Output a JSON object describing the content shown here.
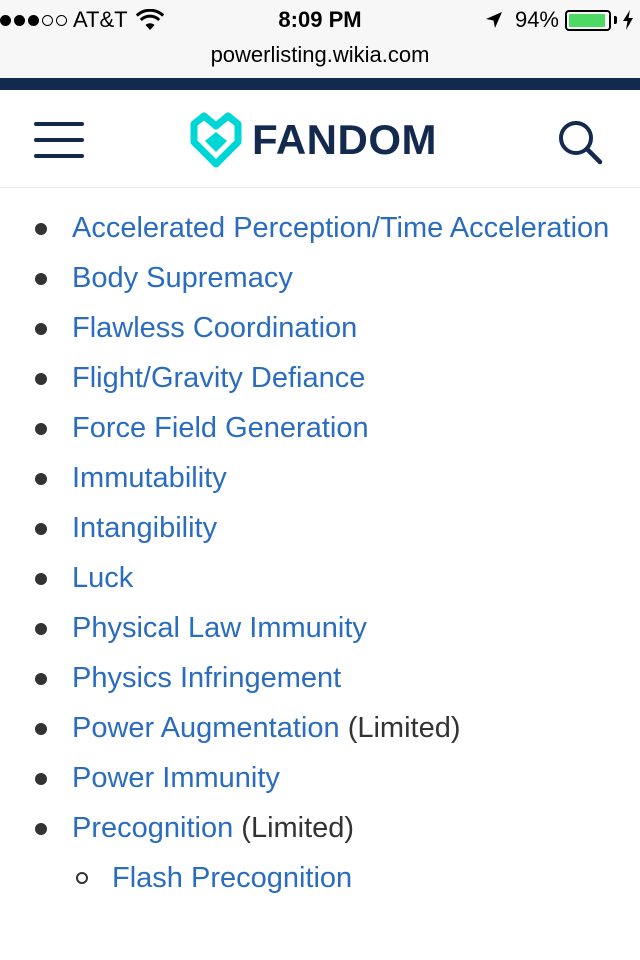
{
  "status_bar": {
    "carrier": "AT&T",
    "time": "8:09 PM",
    "battery_percent": "94%",
    "battery_level": 0.94,
    "battery_color": "#4cd964",
    "signal_bars_filled": 3,
    "signal_bars_total": 5
  },
  "browser": {
    "url": "powerlisting.wikia.com"
  },
  "header": {
    "logo_text": "FANDOM",
    "brand_color": "#132a4e",
    "accent_color": "#00d6d6",
    "menu_icon": "hamburger-menu-icon",
    "search_icon": "search-icon"
  },
  "powers": [
    {
      "label": "Accelerated Perception/Time Acceleration",
      "note": ""
    },
    {
      "label": "Body Supremacy",
      "note": ""
    },
    {
      "label": "Flawless Coordination",
      "note": ""
    },
    {
      "label": "Flight/Gravity Defiance",
      "note": ""
    },
    {
      "label": "Force Field Generation",
      "note": ""
    },
    {
      "label": "Immutability",
      "note": ""
    },
    {
      "label": "Intangibility",
      "note": ""
    },
    {
      "label": "Luck",
      "note": ""
    },
    {
      "label": "Physical Law Immunity",
      "note": ""
    },
    {
      "label": "Physics Infringement",
      "note": ""
    },
    {
      "label": "Power Augmentation",
      "note": "(Limited)"
    },
    {
      "label": "Power Immunity",
      "note": ""
    },
    {
      "label": "Precognition",
      "note": "(Limited)",
      "children": [
        {
          "label": "Flash Precognition"
        }
      ]
    }
  ],
  "link_color": "#2a6cc0"
}
